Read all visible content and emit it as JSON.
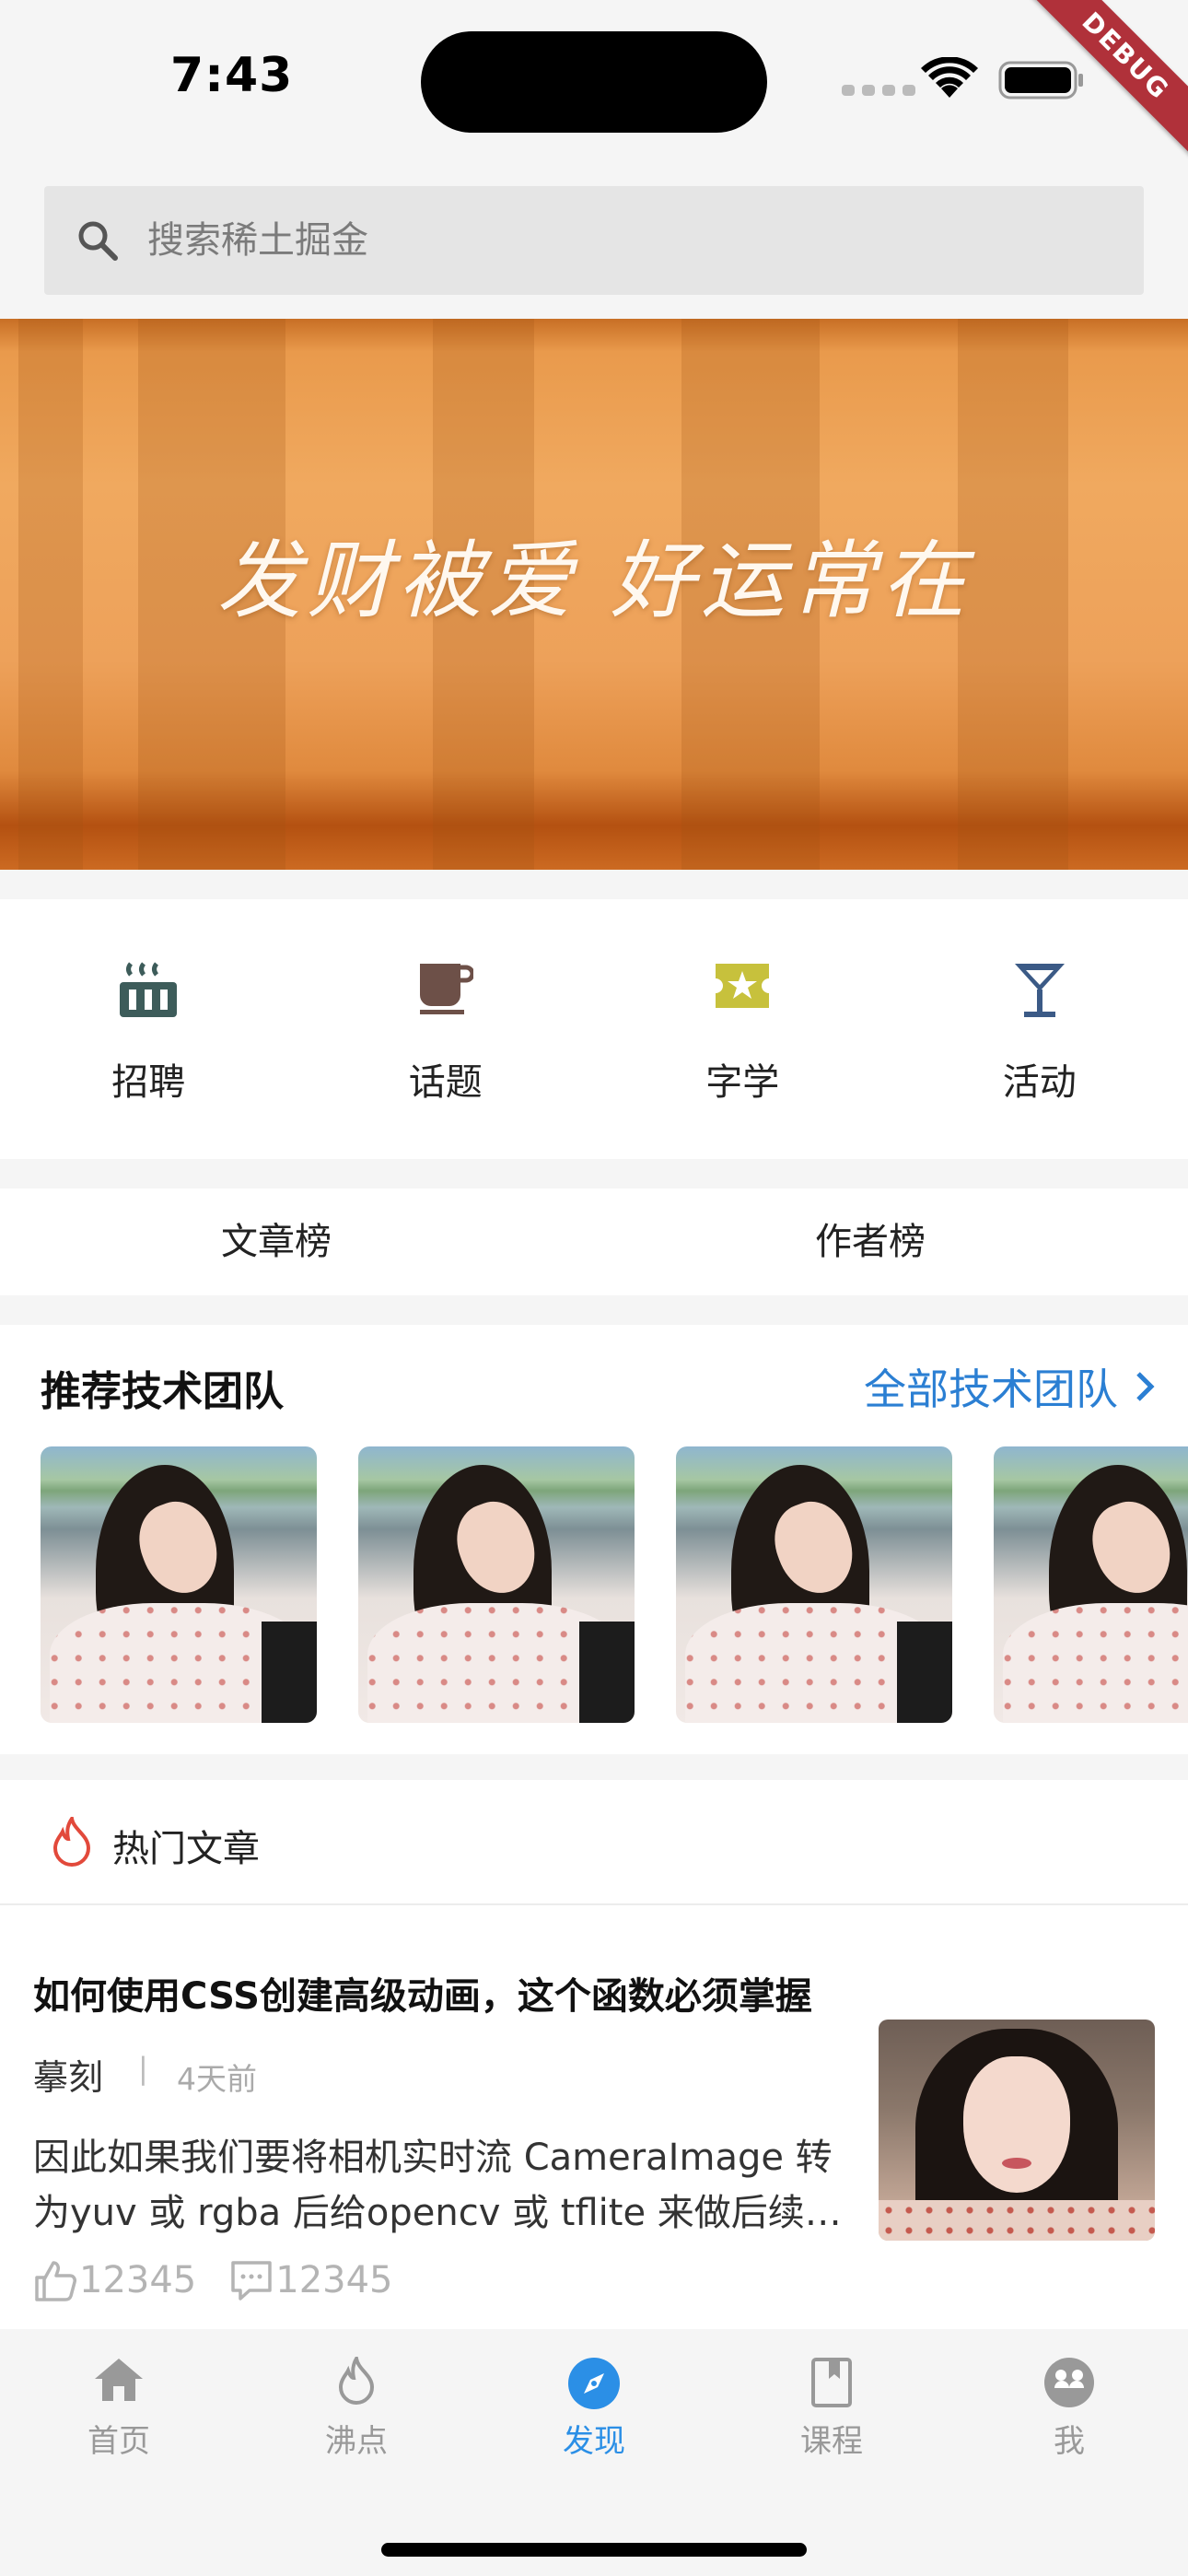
{
  "status_bar": {
    "time": "7:43",
    "debug_label": "DEBUG"
  },
  "search": {
    "placeholder": "搜索稀土掘金"
  },
  "banner": {
    "text": "发财被爱 好运常在"
  },
  "quick_entries": [
    {
      "label": "招聘",
      "icon": "recruit-icon",
      "color": "#3d5c5a"
    },
    {
      "label": "话题",
      "icon": "coffee-icon",
      "color": "#6d5048"
    },
    {
      "label": "字学",
      "icon": "ticket-star-icon",
      "color": "#c7c13c"
    },
    {
      "label": "活动",
      "icon": "cocktail-icon",
      "color": "#3b5a86"
    }
  ],
  "rank_tabs": [
    "文章榜",
    "作者榜"
  ],
  "teams": {
    "title": "推荐技术团队",
    "more_label": "全部技术团队",
    "accent": "#2b7fd3"
  },
  "hot": {
    "title": "热门文章",
    "icon_color": "#e2493b"
  },
  "article": {
    "title": "如何使用CSS创建高级动画，这个函数必须掌握",
    "author": "摹刻",
    "separator": "|",
    "time": "4天前",
    "summary": "因此如果我们要将相机实时流 CameraImage 转为yuv 或 rgba 后给opencv 或 tflite 来做后续处理",
    "likes": "12345",
    "comments": "12345"
  },
  "tab_bar": {
    "items": [
      {
        "label": "首页",
        "icon": "home-icon",
        "active": false
      },
      {
        "label": "沸点",
        "icon": "flame-icon",
        "active": false
      },
      {
        "label": "发现",
        "icon": "compass-icon",
        "active": true
      },
      {
        "label": "课程",
        "icon": "book-icon",
        "active": false
      },
      {
        "label": "我",
        "icon": "profile-icon",
        "active": false
      }
    ],
    "active_color": "#2b8fe6",
    "inactive_color": "#999999"
  }
}
